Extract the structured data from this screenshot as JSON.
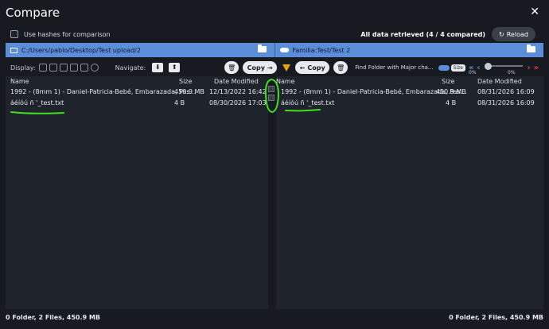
{
  "window": {
    "title": "Compare",
    "close_glyph": "✕"
  },
  "options": {
    "use_hashes_label": "Use hashes for comparison",
    "use_hashes_checked": false
  },
  "summary": "All data retrieved (4 / 4 compared)",
  "reload": {
    "label": "Reload",
    "icon": "refresh-icon"
  },
  "paths": {
    "left": "C:/Users/pablo/Desktop/Test upload/2",
    "right": "Familia:Test/Test 2"
  },
  "toolbar": {
    "display_label": "Display:",
    "navigate_label": "Navigate:",
    "copy_right_label": "Copy",
    "copy_left_label": "Copy",
    "find_label": "Find Folder with Major cha...",
    "size_badge": "Size",
    "pct_left": "0%",
    "pct_right": "0%",
    "slider_value": 0
  },
  "columns": {
    "name": "Name",
    "size": "Size",
    "modified": "Date Modified"
  },
  "left_files": [
    {
      "name": "1992 - (8mm 1) - Daniel-Patricia-Bebé, Embarazada, Pas...",
      "size": "450.9 MB",
      "modified": "12/13/2022 16:42"
    },
    {
      "name": "áéíóú ñ '_test.txt",
      "size": "4 B",
      "modified": "08/30/2026 17:03"
    }
  ],
  "right_files": [
    {
      "name": "1992 - (8mm 1) - Daniel-Patricia-Bebé, Embarazada, Pas...",
      "size": "450.9 MB",
      "modified": "08/31/2026 16:09"
    },
    {
      "name": "áéíóú ñ '_test.txt",
      "size": "4 B",
      "modified": "08/31/2026 16:09"
    }
  ],
  "status": {
    "left": "0 Folder, 2 Files, 450.9 MB",
    "right": "0 Folder, 2 Files, 450.9 MB"
  },
  "colors": {
    "accent": "#5b8dd9",
    "annotation": "#3ee020",
    "filter": "#e9a400",
    "danger": "#e04040"
  }
}
